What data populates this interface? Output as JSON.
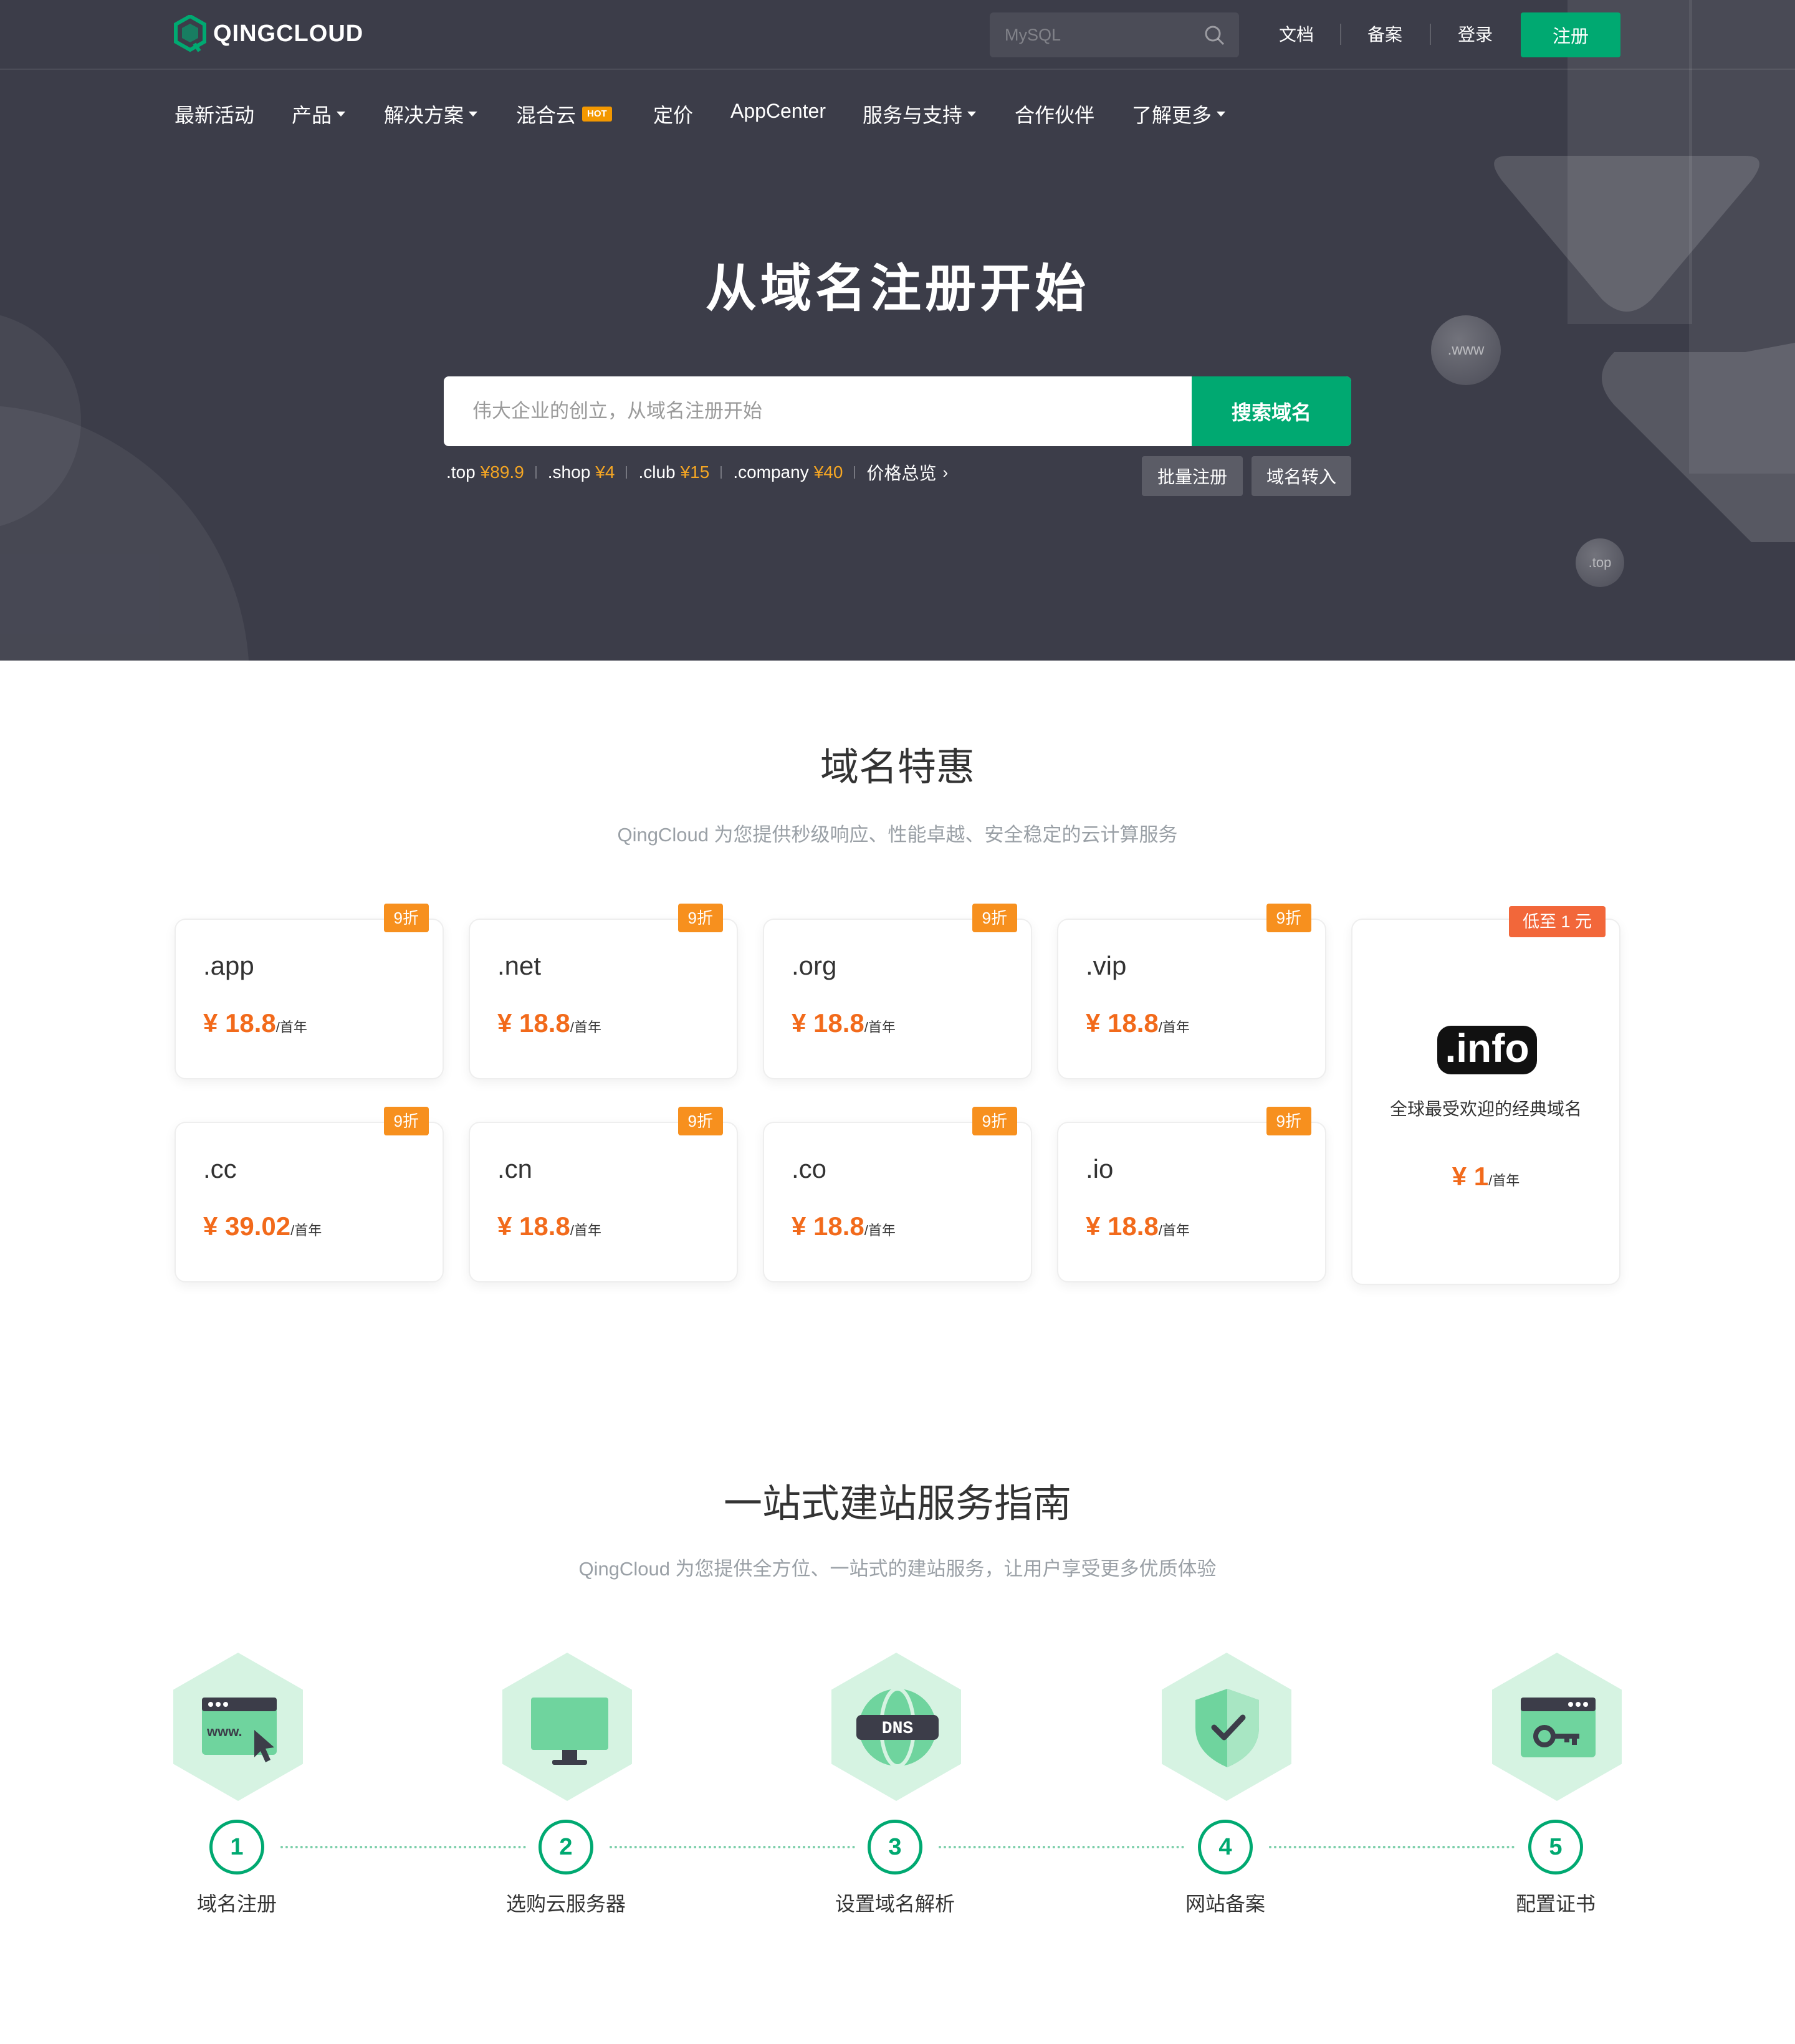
{
  "brand": {
    "name": "QINGCLOUD",
    "accent": "#00a971",
    "hero_bg": "#3c3d49",
    "price_color": "#f26a1b",
    "badge_color": "#f7901e"
  },
  "topbar": {
    "search_placeholder": "MySQL",
    "links": {
      "docs": "文档",
      "beian": "备案",
      "login": "登录"
    },
    "register": "注册"
  },
  "nav": {
    "items": [
      {
        "label": "最新活动"
      },
      {
        "label": "产品",
        "dropdown": true
      },
      {
        "label": "解决方案",
        "dropdown": true
      },
      {
        "label": "混合云",
        "badge": "HOT"
      },
      {
        "label": "定价"
      },
      {
        "label": "AppCenter"
      },
      {
        "label": "服务与支持",
        "dropdown": true
      },
      {
        "label": "合作伙伴"
      },
      {
        "label": "了解更多",
        "dropdown": true
      }
    ]
  },
  "hero": {
    "title": "从域名注册开始",
    "search_placeholder": "伟大企业的创立，从域名注册开始",
    "search_button": "搜索域名",
    "quick_prices": [
      {
        "tld": ".top",
        "price": "¥89.9"
      },
      {
        "tld": ".shop",
        "price": "¥4"
      },
      {
        "tld": ".club",
        "price": "¥15"
      },
      {
        "tld": ".company",
        "price": "¥40"
      }
    ],
    "all_prices": "价格总览",
    "bulk_register": "批量注册",
    "transfer": "域名转入",
    "bubbles": {
      "www": ".www",
      "top": ".top"
    }
  },
  "deals": {
    "title": "域名特惠",
    "subtitle": "QingCloud 为您提供秒级响应、性能卓越、安全稳定的云计算服务",
    "cards": [
      {
        "tld": ".app",
        "price": "¥ 18.8",
        "unit": "/首年",
        "badge": "9折"
      },
      {
        "tld": ".net",
        "price": "¥ 18.8",
        "unit": "/首年",
        "badge": "9折"
      },
      {
        "tld": ".org",
        "price": "¥ 18.8",
        "unit": "/首年",
        "badge": "9折"
      },
      {
        "tld": ".vip",
        "price": "¥ 18.8",
        "unit": "/首年",
        "badge": "9折"
      },
      {
        "tld": ".cc",
        "price": "¥ 39.02",
        "unit": "/首年",
        "badge": "9折"
      },
      {
        "tld": ".cn",
        "price": "¥ 18.8",
        "unit": "/首年",
        "badge": "9折"
      },
      {
        "tld": ".co",
        "price": "¥ 18.8",
        "unit": "/首年",
        "badge": "9折"
      },
      {
        "tld": ".io",
        "price": "¥ 18.8",
        "unit": "/首年",
        "badge": "9折"
      }
    ],
    "feature": {
      "badge": "低至 1 元",
      "logo_text": ".info",
      "description": "全球最受欢迎的经典域名",
      "price": "¥ 1",
      "unit": "/首年"
    }
  },
  "guide": {
    "title": "一站式建站服务指南",
    "subtitle": "QingCloud 为您提供全方位、一站式的建站服务，让用户享受更多优质体验",
    "steps": [
      {
        "num": "1",
        "label": "域名注册",
        "icon": "www-browser-icon"
      },
      {
        "num": "2",
        "label": "选购云服务器",
        "icon": "monitor-icon"
      },
      {
        "num": "3",
        "label": "设置域名解析",
        "icon": "dns-globe-icon"
      },
      {
        "num": "4",
        "label": "网站备案",
        "icon": "shield-check-icon"
      },
      {
        "num": "5",
        "label": "配置证书",
        "icon": "certificate-key-icon"
      }
    ]
  }
}
